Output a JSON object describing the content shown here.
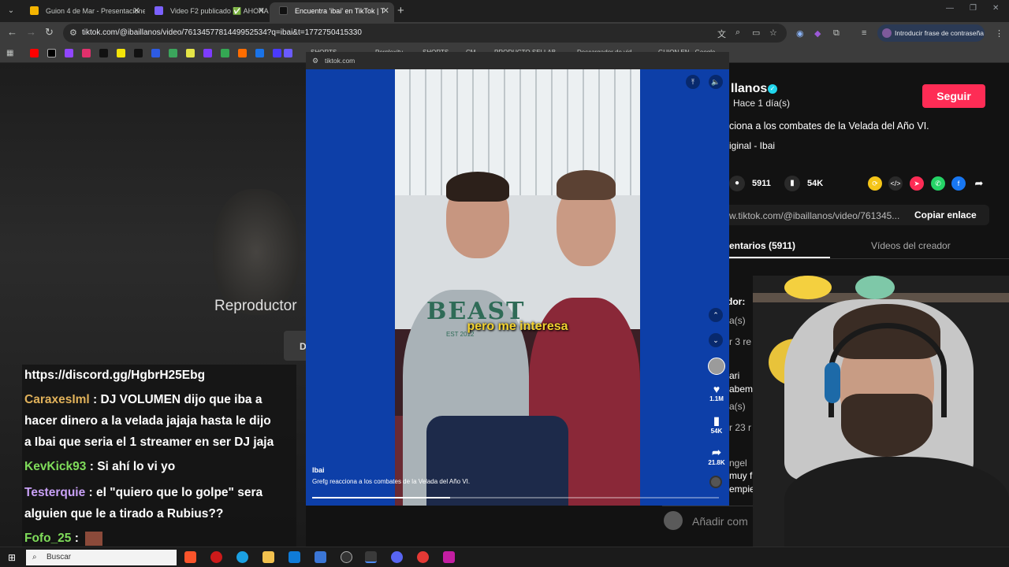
{
  "browser": {
    "tabs": [
      {
        "title": "Guion 4 de Mar - Presentacione",
        "color": "#f4b400"
      },
      {
        "title": "Video F2 publicado ✅ AHORA",
        "color": "#7b61ff"
      },
      {
        "title": "Encuentra 'ibai' en TikTok | T",
        "color": "#111111"
      }
    ],
    "url": "tiktok.com/@ibaillanos/video/7613457781449952534?q=ibai&t=1772750415330",
    "password_prompt": "Introducir frase de contraseña",
    "bookmarks": [
      "SHORTS",
      "Perplexity",
      "SHORTS",
      "CM",
      "PRODUCTO SELLAB",
      "Descargador de vid",
      "GUION EN - Google"
    ]
  },
  "background": {
    "reproductor_text": "Reproductor",
    "d_button": "D"
  },
  "chat": [
    {
      "user": "",
      "color": "#ffffff",
      "text": "https://discord.gg/HgbrH25Ebg"
    },
    {
      "user": "CaraxesIml",
      "color": "#e0b15a",
      "text": " : DJ VOLUMEN dijo que iba a",
      "cont": [
        "hacer dinero a la velada jajaja hasta le dijo",
        "a Ibai que seria el 1 streamer en ser DJ jaja"
      ]
    },
    {
      "user": "KevKick93",
      "color": "#7fdc5a",
      "text": " : Si ahí lo vi yo"
    },
    {
      "user": "Testerquie",
      "color": "#c9a1f7",
      "text": " : el \"quiero que lo golpe\" sera",
      "cont": [
        "alguien que le a tirado a Rubius??"
      ]
    },
    {
      "user": "Fofo_25",
      "color": "#7fdc5a",
      "text": " :"
    }
  ],
  "tiktok_panel": {
    "author": "llanos",
    "time_ago": "Hace 1 día(s)",
    "follow_label": "Seguir",
    "description": "ciona a los combates de la Velada del Año VI.",
    "music": "iginal - Ibai",
    "comments_count": "5911",
    "saves_count": "54K",
    "link_url": "w.tiktok.com/@ibaillanos/video/761345...",
    "copy_link_label": "Copiar enlace",
    "tab_comments": "entarios (5911)",
    "tab_creator": "Vídeos del creador",
    "comment_fragments": [
      "dor:",
      "a(s)",
      "r 3 re",
      "ari",
      "abem",
      "a(s)",
      "r 23 r",
      "ngel",
      "muy f",
      "empie"
    ],
    "add_comment_placeholder": "Añadir com"
  },
  "popup": {
    "domain": "tiktok.com",
    "subtitle": "pero me interesa",
    "hoodie_text": "BEAST",
    "hoodie_sub": "EST 2012",
    "video_author": "Ibai",
    "video_desc": "Grefg reacciona a los combates de la Velada del Año VI.",
    "likes": "1.1M",
    "saves": "54K",
    "shares": "21.8K",
    "progress": 0.34
  },
  "taskbar": {
    "search_placeholder": "Buscar"
  }
}
